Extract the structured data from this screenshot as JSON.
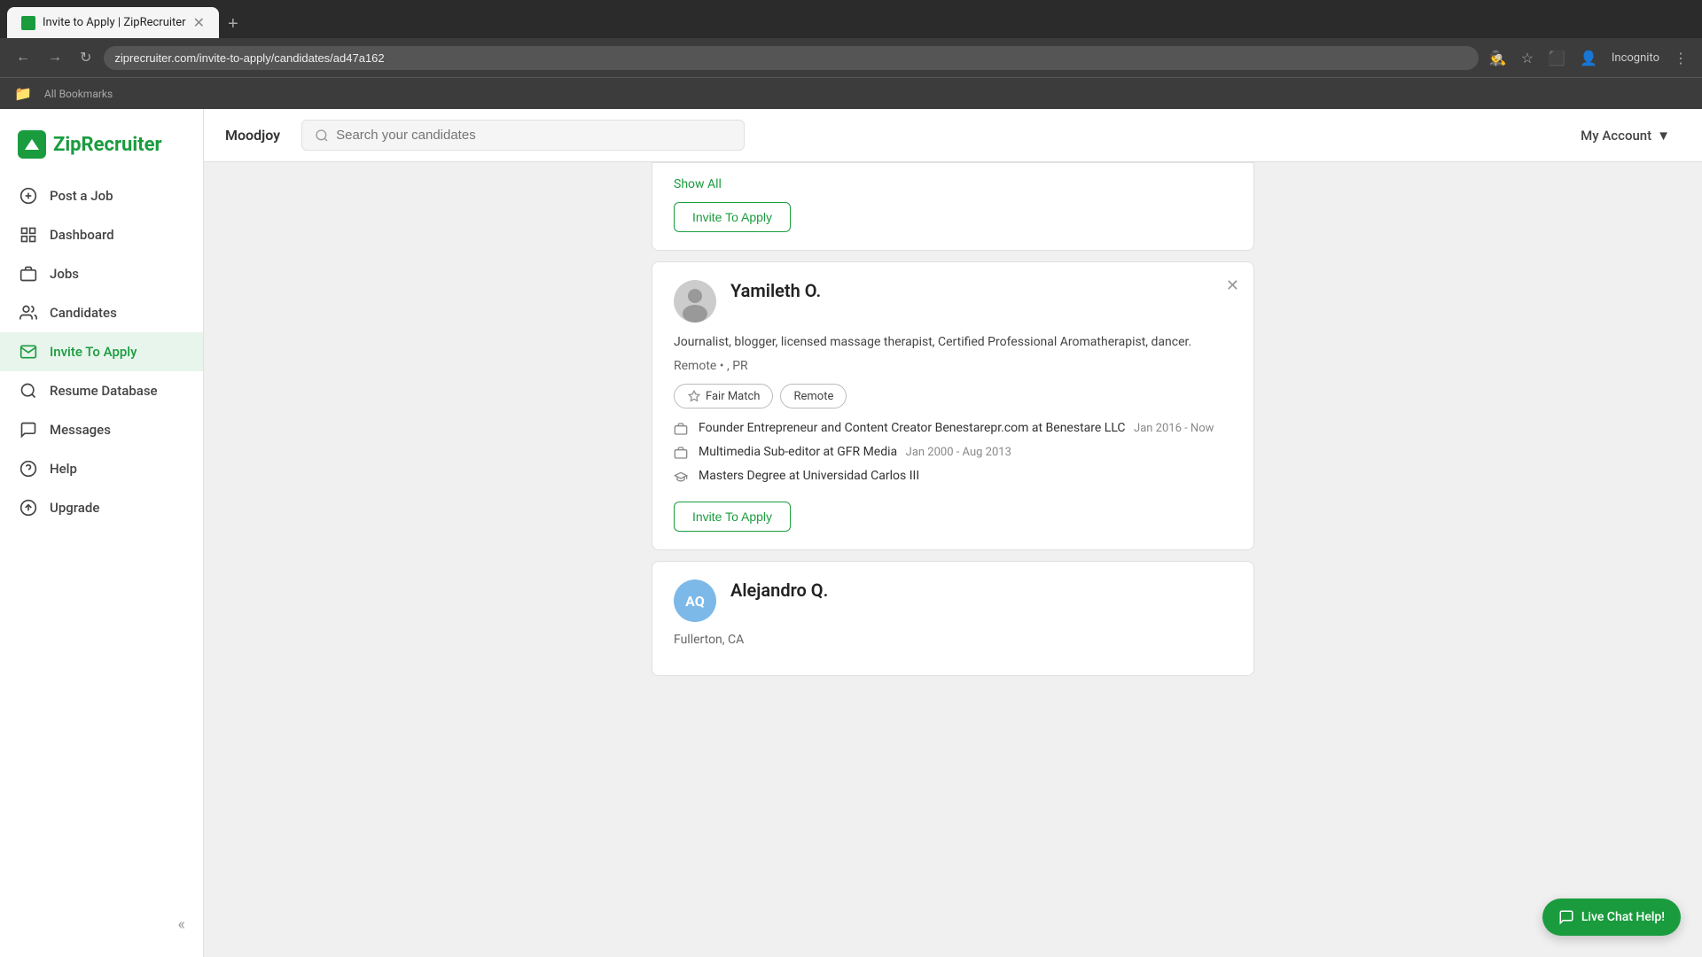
{
  "browser": {
    "tab_title": "Invite to Apply | ZipRecruiter",
    "url": "ziprecruiter.com/invite-to-apply/candidates/ad47a162",
    "new_tab_label": "+",
    "bookmarks_label": "All Bookmarks",
    "incognito_label": "Incognito"
  },
  "sidebar": {
    "logo_text": "ZipRecruiter",
    "items": [
      {
        "id": "post-job",
        "label": "Post a Job",
        "icon": "plus-circle"
      },
      {
        "id": "dashboard",
        "label": "Dashboard",
        "icon": "grid"
      },
      {
        "id": "jobs",
        "label": "Jobs",
        "icon": "briefcase"
      },
      {
        "id": "candidates",
        "label": "Candidates",
        "icon": "users"
      },
      {
        "id": "invite-to-apply",
        "label": "Invite To Apply",
        "icon": "mail",
        "active": true
      },
      {
        "id": "resume-database",
        "label": "Resume Database",
        "icon": "search"
      },
      {
        "id": "messages",
        "label": "Messages",
        "icon": "message-circle"
      },
      {
        "id": "help",
        "label": "Help",
        "icon": "help-circle"
      },
      {
        "id": "upgrade",
        "label": "Upgrade",
        "icon": "arrow-up-circle"
      }
    ]
  },
  "header": {
    "company_name": "Moodjoy",
    "search_placeholder": "Search your candidates",
    "my_account_label": "My Account"
  },
  "page": {
    "show_all_label": "Show All",
    "top_invite_btn": "Invite To Apply",
    "candidate1": {
      "name": "Yamileth O.",
      "description": "Journalist, blogger, licensed massage therapist, Certified Professional Aromatherapist, dancer.",
      "location": "Remote • , PR",
      "tags": [
        {
          "label": "Fair Match",
          "type": "fair"
        },
        {
          "label": "Remote",
          "type": "remote"
        }
      ],
      "experience": [
        {
          "title": "Founder Entrepreneur and Content Creator Benestarepr.com at Benestare LLC",
          "dates": "Jan 2016 - Now"
        },
        {
          "title": "Multimedia Sub-editor at GFR Media",
          "dates": "Jan 2000 - Aug 2013"
        }
      ],
      "education": [
        {
          "degree": "Masters Degree at Universidad Carlos III"
        }
      ],
      "invite_btn": "Invite To Apply"
    },
    "candidate2": {
      "initials": "AQ",
      "name": "Alejandro Q.",
      "location": "Fullerton, CA"
    }
  },
  "live_chat": {
    "label": "Live Chat Help!"
  }
}
